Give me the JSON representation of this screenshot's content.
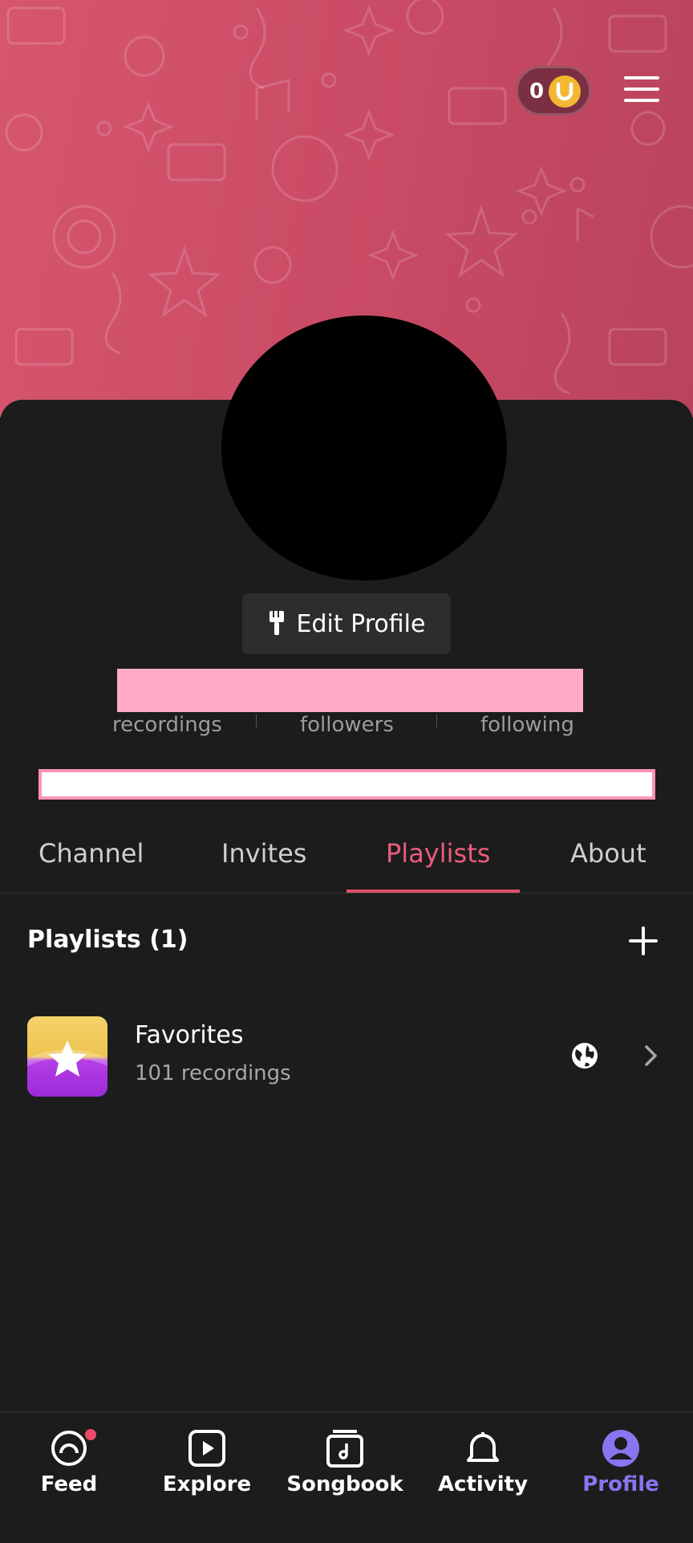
{
  "header": {
    "coin_count": "0",
    "coin_icon": "horseshoe-coin-icon",
    "menu_icon": "hamburger-menu-icon"
  },
  "profile": {
    "edit_label": "Edit Profile",
    "stats": [
      {
        "label": "recordings"
      },
      {
        "label": "followers"
      },
      {
        "label": "following"
      }
    ]
  },
  "tabs": [
    {
      "label": "Channel",
      "active": false
    },
    {
      "label": "Invites",
      "active": false
    },
    {
      "label": "Playlists",
      "active": true
    },
    {
      "label": "About",
      "active": false
    }
  ],
  "playlists": {
    "header": "Playlists (1)",
    "items": [
      {
        "title": "Favorites",
        "subtitle": "101 recordings",
        "visibility_icon": "globe-icon"
      }
    ]
  },
  "nav": [
    {
      "label": "Feed",
      "icon": "feed-icon",
      "badge": true
    },
    {
      "label": "Explore",
      "icon": "play-icon"
    },
    {
      "label": "Songbook",
      "icon": "songbook-icon"
    },
    {
      "label": "Activity",
      "icon": "bell-icon"
    },
    {
      "label": "Profile",
      "icon": "profile-icon",
      "active": true
    }
  ],
  "colors": {
    "accent": "#ec5d78",
    "header_bg": "#cf506a",
    "active_nav": "#8b74f0",
    "background": "#1c1c1d"
  }
}
